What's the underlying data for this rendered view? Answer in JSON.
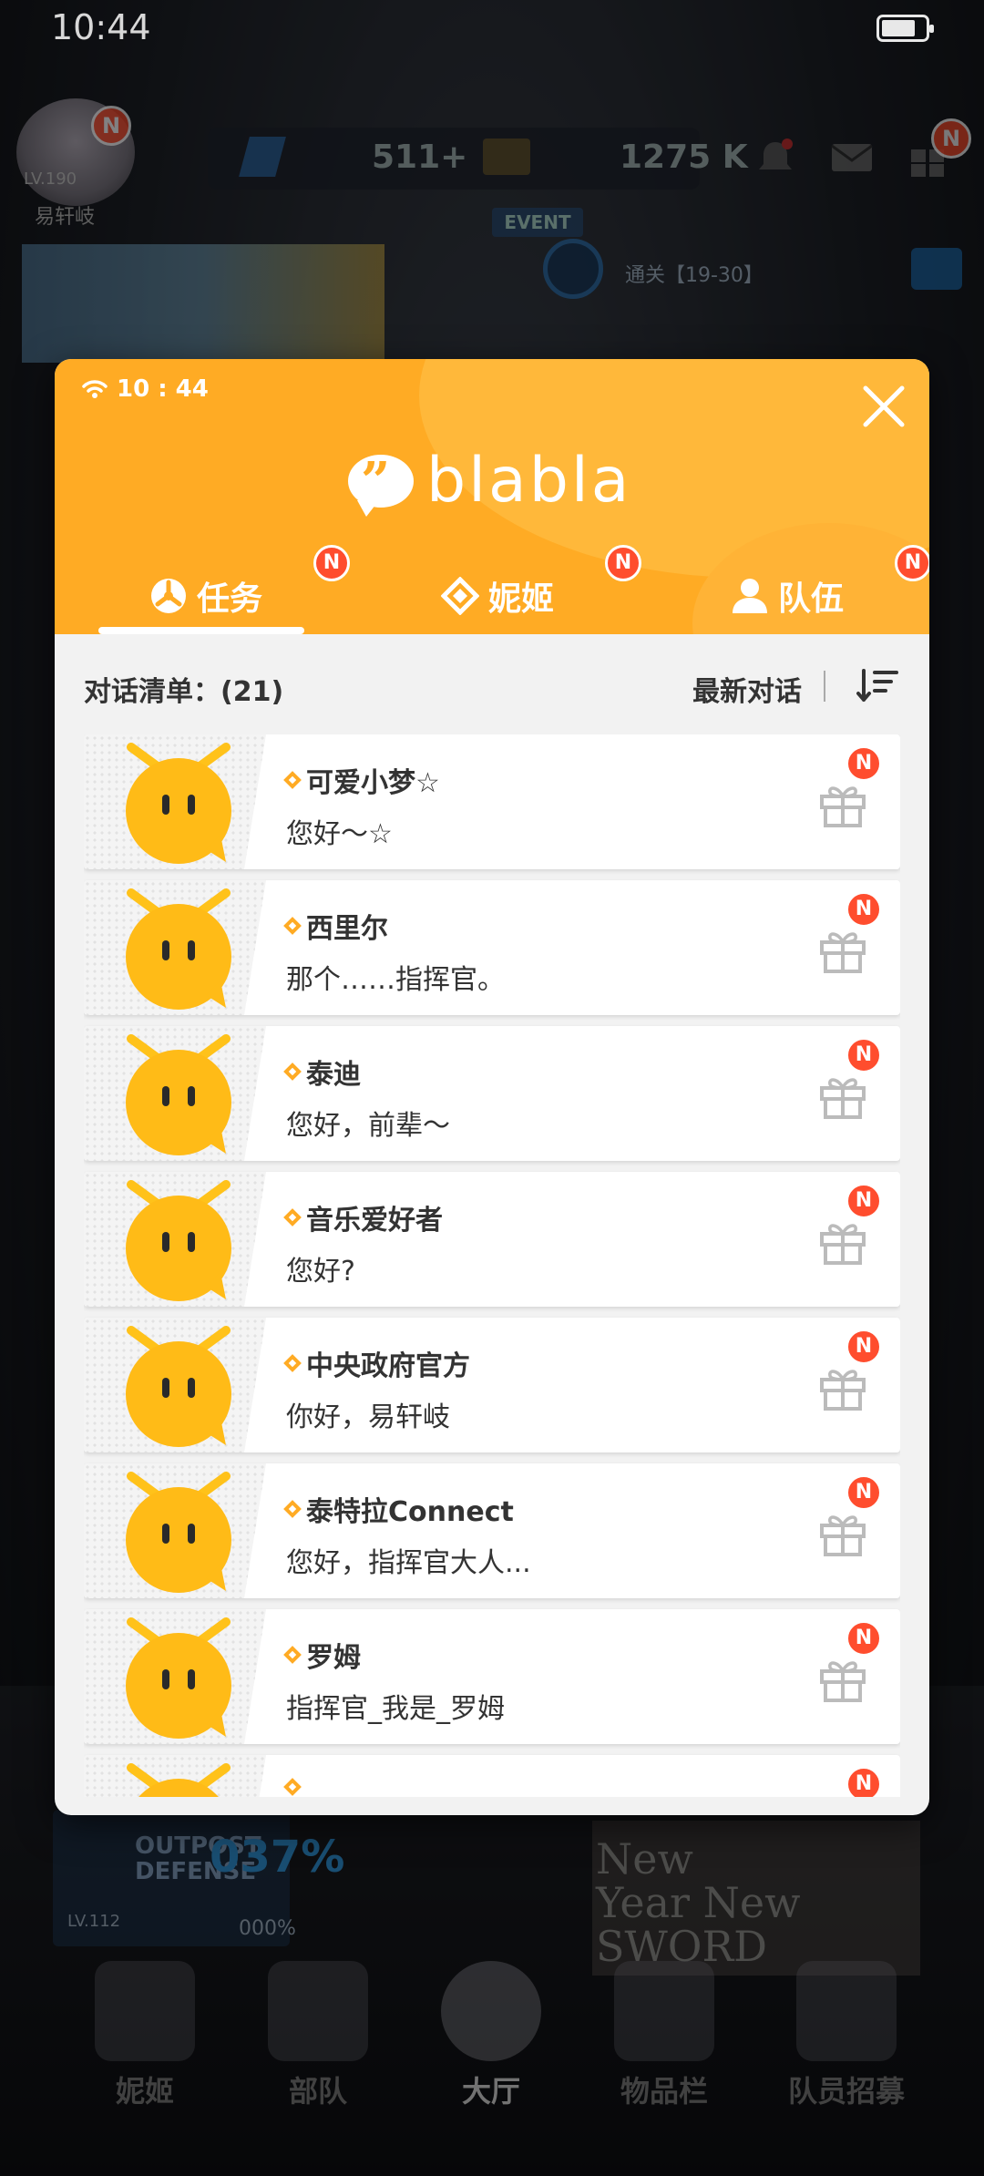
{
  "status_bar": {
    "time": "10:44"
  },
  "game_hud": {
    "player_level": "LV.190",
    "player_name": "易轩岐",
    "currency_gems": "511+",
    "currency_credits": "1275 K",
    "event_tag": "EVENT",
    "event_text": "通关【19-30】",
    "badge": "N"
  },
  "modal": {
    "status_time": "10 : 44",
    "logo_text": "blabla",
    "tabs": [
      {
        "label": "任务",
        "badge": "N"
      },
      {
        "label": "妮姬",
        "badge": "N"
      },
      {
        "label": "队伍",
        "badge": "N"
      }
    ],
    "list_title": "对话清单：(21)",
    "sort_label": "最新对话",
    "conversations": [
      {
        "name": "可爱小梦☆",
        "message": "您好～☆",
        "badge": "N"
      },
      {
        "name": "西里尔",
        "message": "那个……指挥官。",
        "badge": "N"
      },
      {
        "name": "泰迪",
        "message": "您好，前辈～",
        "badge": "N"
      },
      {
        "name": "音乐爱好者",
        "message": "您好?",
        "badge": "N"
      },
      {
        "name": "中央政府官方",
        "message": "你好，易轩岐",
        "badge": "N"
      },
      {
        "name": "泰特拉Connect",
        "message": "您好，指挥官大人...",
        "badge": "N"
      },
      {
        "name": "罗姆",
        "message": "指挥官_我是_罗姆",
        "badge": "N"
      },
      {
        "name": "",
        "message": "",
        "badge": "N"
      }
    ],
    "colors": {
      "accent": "#ffab24",
      "badge": "#ff4d2e"
    }
  },
  "outpost": {
    "title_line1": "OUTPOST",
    "title_line2": "DEFENSE",
    "percent": "037%",
    "level": "LV.112",
    "sub_percent": "000%"
  },
  "event_banner": {
    "line1": "New",
    "line2": "Year New",
    "line3": "SWORD"
  },
  "bottom_nav": [
    {
      "label": "妮姬"
    },
    {
      "label": "部队"
    },
    {
      "label": "大厅"
    },
    {
      "label": "物品栏"
    },
    {
      "label": "队员招募"
    }
  ]
}
